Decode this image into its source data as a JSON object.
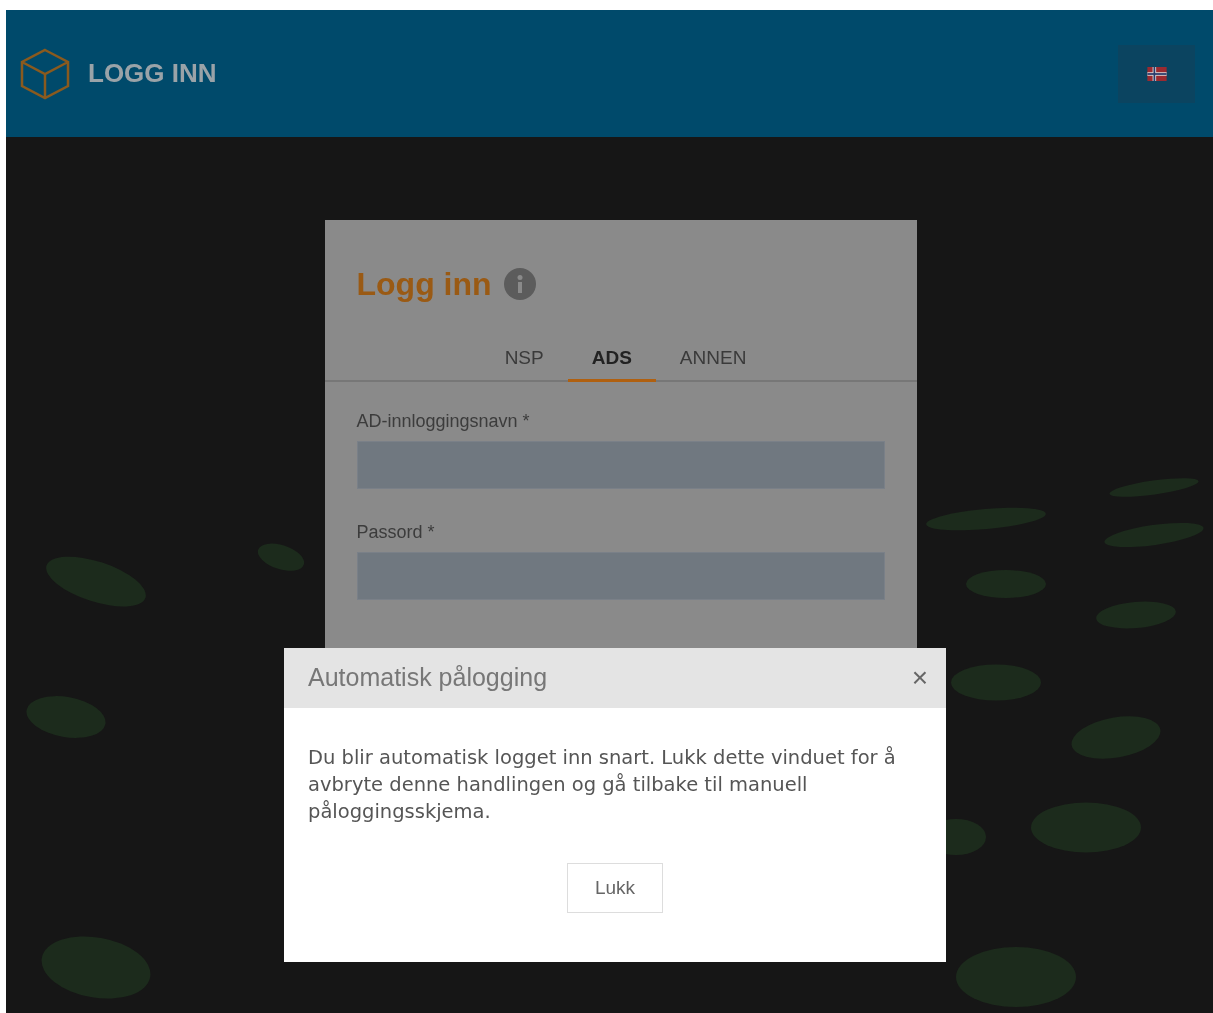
{
  "header": {
    "title": "LOGG INN"
  },
  "login": {
    "title": "Logg inn",
    "tabs": [
      {
        "label": "NSP",
        "selected": false
      },
      {
        "label": "ADS",
        "selected": true
      },
      {
        "label": "ANNEN",
        "selected": false
      }
    ],
    "fields": [
      {
        "label": "AD-innloggingsnavn *"
      },
      {
        "label": "Passord *"
      }
    ]
  },
  "dialog": {
    "title": "Automatisk pålogging",
    "close": "×",
    "message": "Du blir automatisk logget inn snart. Lukk dette vinduet for å avbryte denne handlingen og gå tilbake til manuell påloggingsskjema.",
    "button": "Lukk"
  }
}
